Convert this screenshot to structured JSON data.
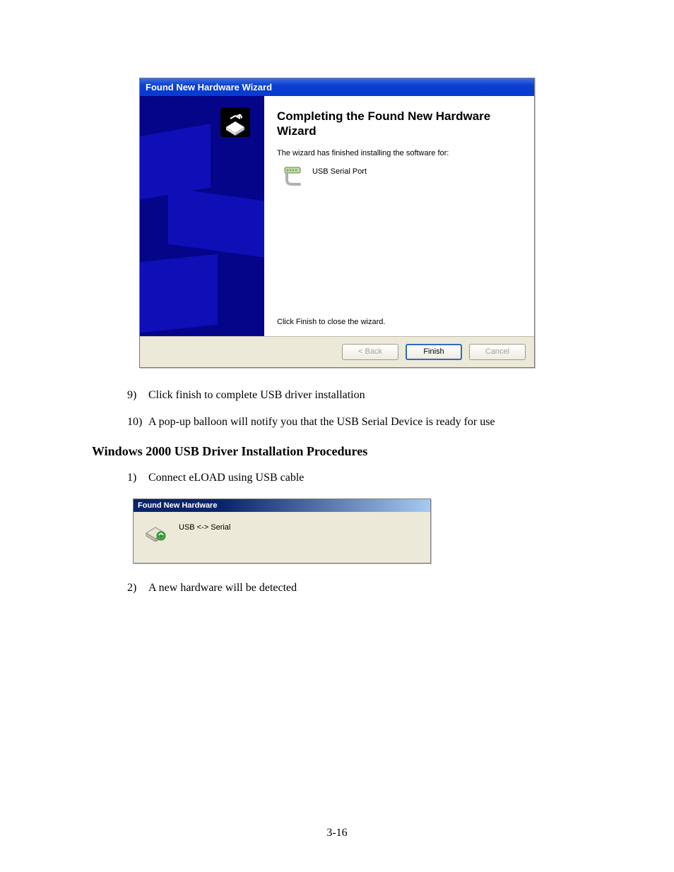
{
  "wizard": {
    "title": "Found New Hardware Wizard",
    "heading": "Completing the Found New Hardware Wizard",
    "desc": "The wizard has finished installing the software for:",
    "device": "USB Serial Port",
    "close_hint": "Click Finish to close the wizard.",
    "buttons": {
      "back": "< Back",
      "finish": "Finish",
      "cancel": "Cancel"
    }
  },
  "steps": {
    "n9_num": "9)",
    "n9": "Click finish to complete USB driver installation",
    "n10_num": "10)",
    "n10": "A pop-up balloon will notify you that the USB Serial Device is ready for use",
    "n1_num": "1)",
    "n1": "Connect eLOAD using USB cable",
    "n2_num": "2)",
    "n2": "A new hardware will be detected"
  },
  "section_heading": "Windows 2000 USB Driver Installation Procedures",
  "fnh": {
    "title": "Found New Hardware",
    "device": "USB <-> Serial"
  },
  "page_number": "3-16"
}
